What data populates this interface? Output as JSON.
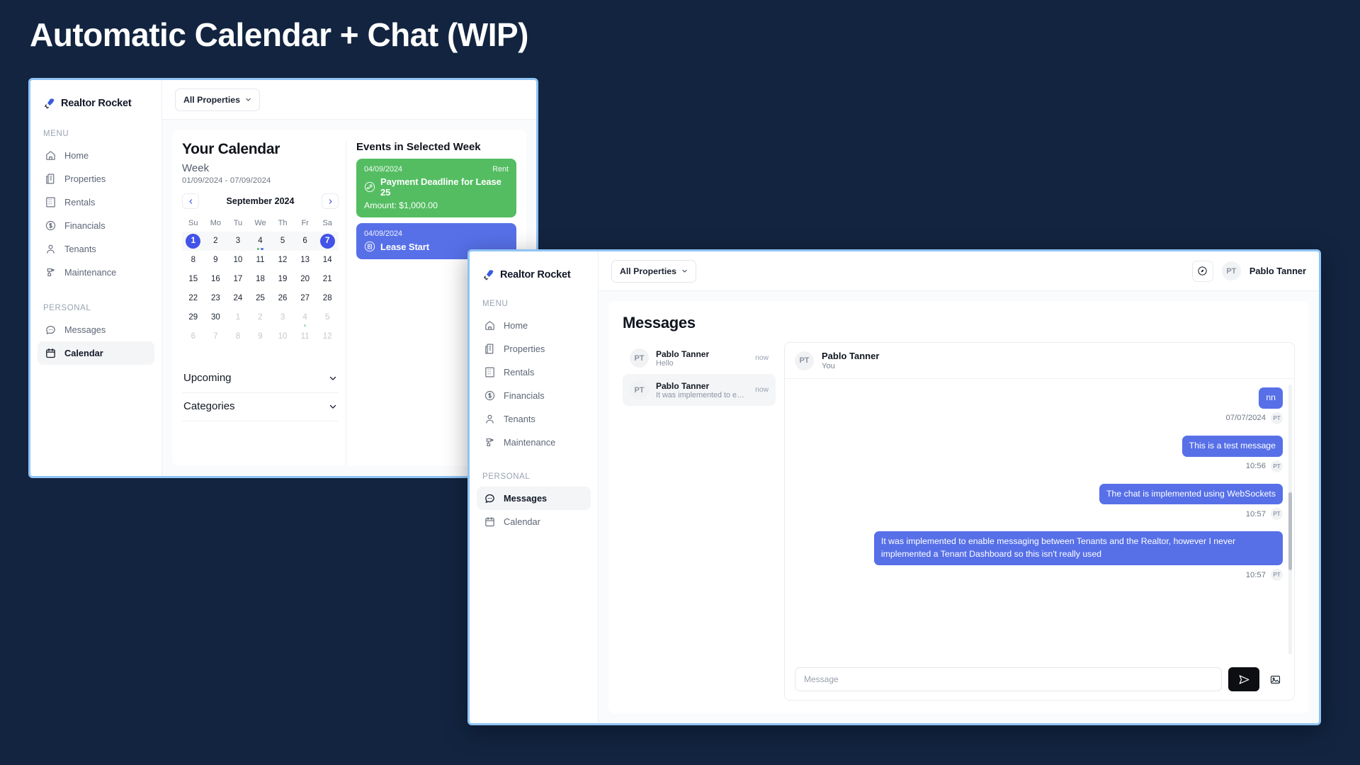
{
  "page": {
    "title": "Automatic Calendar + Chat (WIP)"
  },
  "brand": {
    "name": "Realtor Rocket",
    "logo_icon": "rocket-icon"
  },
  "nav": {
    "section_menu": "MENU",
    "section_personal": "PERSONAL",
    "menu_items": [
      {
        "label": "Home",
        "icon": "home-icon"
      },
      {
        "label": "Properties",
        "icon": "building-icon"
      },
      {
        "label": "Rentals",
        "icon": "apartment-icon"
      },
      {
        "label": "Financials",
        "icon": "dollar-circle-icon"
      },
      {
        "label": "Tenants",
        "icon": "person-icon"
      },
      {
        "label": "Maintenance",
        "icon": "drill-icon"
      }
    ],
    "personal_items": [
      {
        "label": "Messages",
        "icon": "chat-bubble-icon"
      },
      {
        "label": "Calendar",
        "icon": "calendar-icon"
      }
    ]
  },
  "topbar": {
    "property_filter": "All Properties",
    "chevron_icon": "chevron-down-icon",
    "compass_icon": "compass-icon",
    "user_initials": "PT",
    "user_name": "Pablo Tanner"
  },
  "calendar_window": {
    "title": "Your Calendar",
    "view": "Week",
    "range": "01/09/2024 - 07/09/2024",
    "month": "September 2024",
    "prev_icon": "chevron-left-icon",
    "next_icon": "chevron-right-icon",
    "dow": [
      "Su",
      "Mo",
      "Tu",
      "We",
      "Th",
      "Fr",
      "Sa"
    ],
    "weeks": [
      [
        {
          "n": "1",
          "state": "selected",
          "row": "active"
        },
        {
          "n": "2",
          "state": "normal",
          "row": "active"
        },
        {
          "n": "3",
          "state": "normal",
          "row": "active"
        },
        {
          "n": "4",
          "state": "normal",
          "row": "active",
          "dots": [
            "#54bd62",
            "#5770e8"
          ]
        },
        {
          "n": "5",
          "state": "normal",
          "row": "active"
        },
        {
          "n": "6",
          "state": "normal",
          "row": "active"
        },
        {
          "n": "7",
          "state": "selected",
          "row": "active"
        }
      ],
      [
        {
          "n": "8"
        },
        {
          "n": "9"
        },
        {
          "n": "10"
        },
        {
          "n": "11"
        },
        {
          "n": "12"
        },
        {
          "n": "13"
        },
        {
          "n": "14"
        }
      ],
      [
        {
          "n": "15"
        },
        {
          "n": "16"
        },
        {
          "n": "17"
        },
        {
          "n": "18"
        },
        {
          "n": "19"
        },
        {
          "n": "20"
        },
        {
          "n": "21"
        }
      ],
      [
        {
          "n": "22"
        },
        {
          "n": "23"
        },
        {
          "n": "24"
        },
        {
          "n": "25"
        },
        {
          "n": "26"
        },
        {
          "n": "27"
        },
        {
          "n": "28"
        }
      ],
      [
        {
          "n": "29"
        },
        {
          "n": "30"
        },
        {
          "n": "1",
          "state": "muted"
        },
        {
          "n": "2",
          "state": "muted"
        },
        {
          "n": "3",
          "state": "muted"
        },
        {
          "n": "4",
          "state": "muted",
          "dots": [
            "#a9dcb0"
          ]
        },
        {
          "n": "5",
          "state": "muted"
        }
      ],
      [
        {
          "n": "6",
          "state": "muted"
        },
        {
          "n": "7",
          "state": "muted"
        },
        {
          "n": "8",
          "state": "muted"
        },
        {
          "n": "9",
          "state": "muted"
        },
        {
          "n": "10",
          "state": "muted"
        },
        {
          "n": "11",
          "state": "muted"
        },
        {
          "n": "12",
          "state": "muted"
        }
      ]
    ],
    "accordions": [
      {
        "label": "Upcoming",
        "icon": "chevron-down-icon"
      },
      {
        "label": "Categories",
        "icon": "chevron-down-icon"
      }
    ],
    "events_title": "Events in Selected Week",
    "events": [
      {
        "date": "04/09/2024",
        "badge": "Rent",
        "name": "Payment Deadline for Lease 25",
        "amount": "Amount: $1,000.00",
        "color": "#54bd62",
        "icon": "hand-coins-icon"
      },
      {
        "date": "04/09/2024",
        "badge": "",
        "name": "Lease Start",
        "amount": "",
        "color": "#5770e8",
        "icon": "contract-icon"
      }
    ]
  },
  "chat_window": {
    "title": "Messages",
    "conversations": [
      {
        "initials": "PT",
        "name": "Pablo Tanner",
        "preview": "Hello",
        "time": "now",
        "active": false
      },
      {
        "initials": "PT",
        "name": "Pablo Tanner",
        "preview": "It was implemented to ena...",
        "time": "now",
        "active": true
      }
    ],
    "thread": {
      "initials": "PT",
      "name": "Pablo Tanner",
      "subtitle": "You",
      "messages": [
        {
          "text": "nn",
          "time": "07/07/2024",
          "initials": "PT"
        },
        {
          "text": "This is a test message",
          "time": "10:56",
          "initials": "PT"
        },
        {
          "text": "The chat is implemented using WebSockets",
          "time": "10:57",
          "initials": "PT"
        },
        {
          "text": "It was implemented to enable messaging between Tenants and the Realtor, however I never implemented a Tenant Dashboard so this isn't really used",
          "time": "10:57",
          "initials": "PT"
        }
      ]
    },
    "composer": {
      "placeholder": "Message",
      "value": "",
      "send_icon": "send-icon",
      "image_icon": "image-icon"
    }
  }
}
